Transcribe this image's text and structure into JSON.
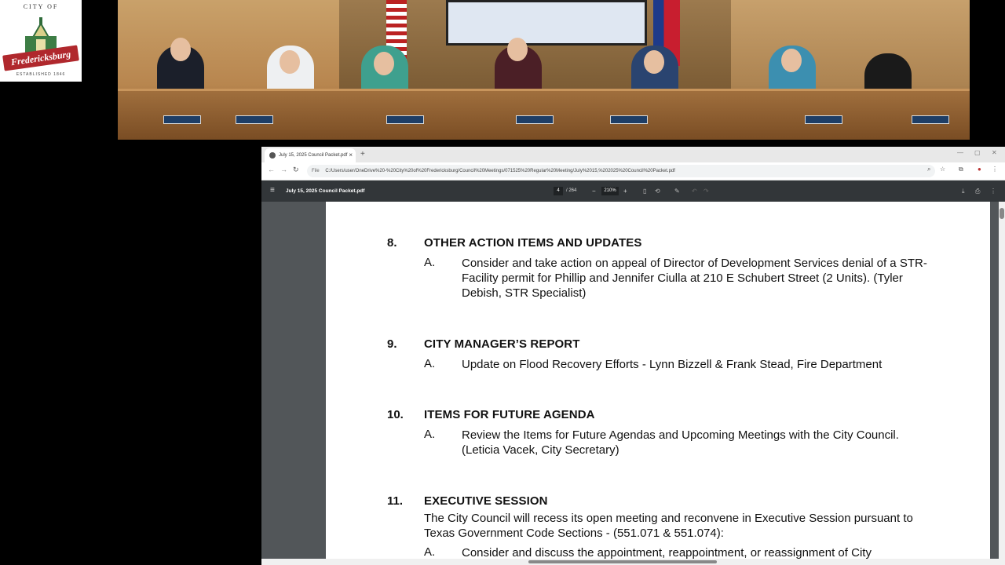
{
  "logo": {
    "arc_text": "CITY OF",
    "banner_text": "Fredericksburg",
    "est_text": "ESTABLISHED 1846"
  },
  "browser": {
    "tab_title": "July 15, 2025 Council Packet.pdf",
    "file_label": "File",
    "url": "C:/Users/user/OneDrive%20-%20City%20of%20Fredericksburg/Council%20Meetings/071525%20Regular%20Meeting/July%2015,%202025%20Council%20Packet.pdf"
  },
  "pdf_toolbar": {
    "doc_title": "July 15, 2025 Council Packet.pdf",
    "page_current": "4",
    "page_total": "/ 264",
    "zoom": "210%"
  },
  "document": {
    "sections": [
      {
        "number": "8.",
        "title": "OTHER ACTION ITEMS AND UPDATES",
        "items": [
          {
            "letter": "A.",
            "text": "Consider and take action on appeal of Director of Development Services denial of a STR-Facility permit for Phillip and Jennifer Ciulla at 210 E Schubert Street (2 Units). (Tyler Debish, STR Specialist)"
          }
        ]
      },
      {
        "number": "9.",
        "title": "CITY MANAGER’S REPORT",
        "items": [
          {
            "letter": "A.",
            "text": "Update on Flood Recovery Efforts - Lynn Bizzell & Frank Stead, Fire Department"
          }
        ]
      },
      {
        "number": "10.",
        "title": "ITEMS FOR FUTURE AGENDA",
        "items": [
          {
            "letter": "A.",
            "text": "Review the Items for Future Agendas and Upcoming Meetings with the City Council. (Leticia Vacek, City Secretary)"
          }
        ]
      },
      {
        "number": "11.",
        "title": "EXECUTIVE SESSION",
        "intro": "The City Council will recess its open meeting and reconvene in Executive Session pursuant to Texas Government Code Sections - (551.071 & 551.074):",
        "items": [
          {
            "letter": "A.",
            "text": "Consider and discuss the appointment, reappointment, or reassignment of City"
          }
        ]
      }
    ]
  }
}
